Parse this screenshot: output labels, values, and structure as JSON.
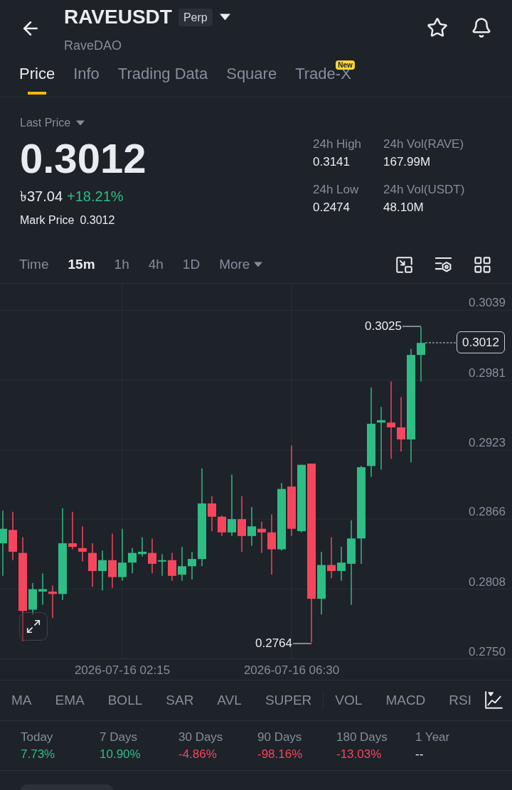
{
  "header": {
    "symbol": "RAVEUSDT",
    "contract_badge": "Perp",
    "name": "RaveDAO"
  },
  "tabs": [
    {
      "label": "Price",
      "selected": true
    },
    {
      "label": "Info",
      "selected": false
    },
    {
      "label": "Trading Data",
      "selected": false
    },
    {
      "label": "Square",
      "selected": false
    },
    {
      "label": "Trade-X",
      "selected": false,
      "badge": "New"
    }
  ],
  "price": {
    "label": "Last Price",
    "value": "0.3012",
    "fiat": "৳37.04",
    "change": {
      "text": "+18.21%",
      "color": "#2ebd85"
    },
    "mark_label": "Mark Price",
    "mark_value": "0.3012"
  },
  "stats_24h": [
    {
      "label": "24h High",
      "value": "0.3141"
    },
    {
      "label": "24h Vol(RAVE)",
      "value": "167.99M"
    },
    {
      "label": "24h Low",
      "value": "0.2474"
    },
    {
      "label": "24h Vol(USDT)",
      "value": "48.10M"
    }
  ],
  "timeframes": [
    {
      "label": "Time",
      "selected": false,
      "kind": "option"
    },
    {
      "label": "15m",
      "selected": true,
      "kind": "option"
    },
    {
      "label": "1h",
      "selected": false,
      "kind": "option"
    },
    {
      "label": "4h",
      "selected": false,
      "kind": "option"
    },
    {
      "label": "1D",
      "selected": false,
      "kind": "option"
    },
    {
      "label": "More",
      "selected": false,
      "kind": "menu"
    }
  ],
  "chart": {
    "high_label": "0.3025",
    "low_label": "0.2764",
    "last_price_tag": "0.3012",
    "chart_data": {
      "type": "candlestick",
      "grid": true,
      "categories": [
        null,
        null,
        null,
        null,
        null,
        null,
        null,
        null,
        null,
        null,
        null,
        null,
        "2026-07-16 02:15",
        null,
        null,
        null,
        null,
        null,
        null,
        null,
        null,
        null,
        null,
        null,
        null,
        null,
        null,
        null,
        null,
        "2026-07-16 06:30",
        null,
        null,
        null,
        null,
        null,
        null,
        null,
        null,
        null,
        null,
        null,
        null,
        null
      ],
      "ohlc": [
        [
          0.2846,
          0.2873,
          0.2819,
          0.2858
        ],
        [
          0.2857,
          0.2872,
          0.2832,
          0.2839
        ],
        [
          0.2838,
          0.2851,
          0.2765,
          0.279
        ],
        [
          0.2791,
          0.2813,
          0.2787,
          0.2808
        ],
        [
          0.2806,
          0.2821,
          0.2795,
          0.2808
        ],
        [
          0.2806,
          0.2811,
          0.2784,
          0.2804
        ],
        [
          0.2804,
          0.2875,
          0.2799,
          0.2846
        ],
        [
          0.2846,
          0.2872,
          0.2841,
          0.2843
        ],
        [
          0.2842,
          0.286,
          0.2831,
          0.2839
        ],
        [
          0.2838,
          0.2846,
          0.281,
          0.2823
        ],
        [
          0.2823,
          0.284,
          0.2807,
          0.2832
        ],
        [
          0.2832,
          0.2854,
          0.2809,
          0.2818
        ],
        [
          0.2818,
          0.2858,
          0.2815,
          0.283
        ],
        [
          0.283,
          0.2842,
          0.2821,
          0.2838
        ],
        [
          0.2837,
          0.2851,
          0.2835,
          0.2839
        ],
        [
          0.2838,
          0.285,
          0.2821,
          0.2829
        ],
        [
          0.2831,
          0.2837,
          0.2819,
          0.2832
        ],
        [
          0.2832,
          0.2838,
          0.2815,
          0.2819
        ],
        [
          0.282,
          0.2843,
          0.2815,
          0.2827
        ],
        [
          0.2827,
          0.2839,
          0.2816,
          0.2833
        ],
        [
          0.2833,
          0.2908,
          0.2827,
          0.2879
        ],
        [
          0.2879,
          0.2885,
          0.2856,
          0.2868
        ],
        [
          0.2868,
          0.2869,
          0.2852,
          0.2855
        ],
        [
          0.2855,
          0.2903,
          0.2852,
          0.2866
        ],
        [
          0.2866,
          0.2885,
          0.2839,
          0.2852
        ],
        [
          0.2852,
          0.2876,
          0.2844,
          0.286
        ],
        [
          0.2858,
          0.2864,
          0.2838,
          0.2855
        ],
        [
          0.2855,
          0.287,
          0.282,
          0.2841
        ],
        [
          0.2841,
          0.2896,
          0.284,
          0.2891
        ],
        [
          0.2893,
          0.2927,
          0.2852,
          0.2858
        ],
        [
          0.2856,
          0.2911,
          0.2855,
          0.2911
        ],
        [
          0.2912,
          0.2912,
          0.2764,
          0.28
        ],
        [
          0.28,
          0.2839,
          0.2787,
          0.2828
        ],
        [
          0.2828,
          0.2851,
          0.2817,
          0.2823
        ],
        [
          0.2823,
          0.2843,
          0.2815,
          0.283
        ],
        [
          0.2829,
          0.2865,
          0.2795,
          0.285
        ],
        [
          0.285,
          0.291,
          0.2829,
          0.2909
        ],
        [
          0.291,
          0.2975,
          0.2901,
          0.2945
        ],
        [
          0.2946,
          0.2959,
          0.2907,
          0.2948
        ],
        [
          0.2946,
          0.298,
          0.2916,
          0.2942
        ],
        [
          0.2942,
          0.2967,
          0.2922,
          0.2932
        ],
        [
          0.2932,
          0.3007,
          0.2913,
          0.3002
        ],
        [
          0.3002,
          0.3025,
          0.298,
          0.3012
        ]
      ],
      "ylim": [
        0.275,
        0.3061
      ],
      "yticks": [
        {
          "value": 0.3039,
          "label": "0.3039"
        },
        {
          "value": 0.2981,
          "label": "0.2981"
        },
        {
          "value": 0.2923,
          "label": "0.2923"
        },
        {
          "value": 0.2866,
          "label": "0.2866"
        },
        {
          "value": 0.2808,
          "label": "0.2808"
        },
        {
          "value": 0.275,
          "label": "0.2750"
        }
      ]
    }
  },
  "main_indicators": [
    "MA",
    "EMA",
    "BOLL",
    "SAR",
    "AVL",
    "SUPER"
  ],
  "sub_indicators": [
    "VOL",
    "MACD",
    "RSI"
  ],
  "performance": [
    {
      "label": "Today",
      "value": "7.73%",
      "color": "#2ebd85"
    },
    {
      "label": "7 Days",
      "value": "10.90%",
      "color": "#2ebd85"
    },
    {
      "label": "30 Days",
      "value": "-4.86%",
      "color": "#f6465d"
    },
    {
      "label": "90 Days",
      "value": "-98.16%",
      "color": "#f6465d"
    },
    {
      "label": "180 Days",
      "value": "-13.03%",
      "color": "#f6465d"
    },
    {
      "label": "1 Year",
      "value": "--",
      "color": "#eaecef"
    }
  ]
}
